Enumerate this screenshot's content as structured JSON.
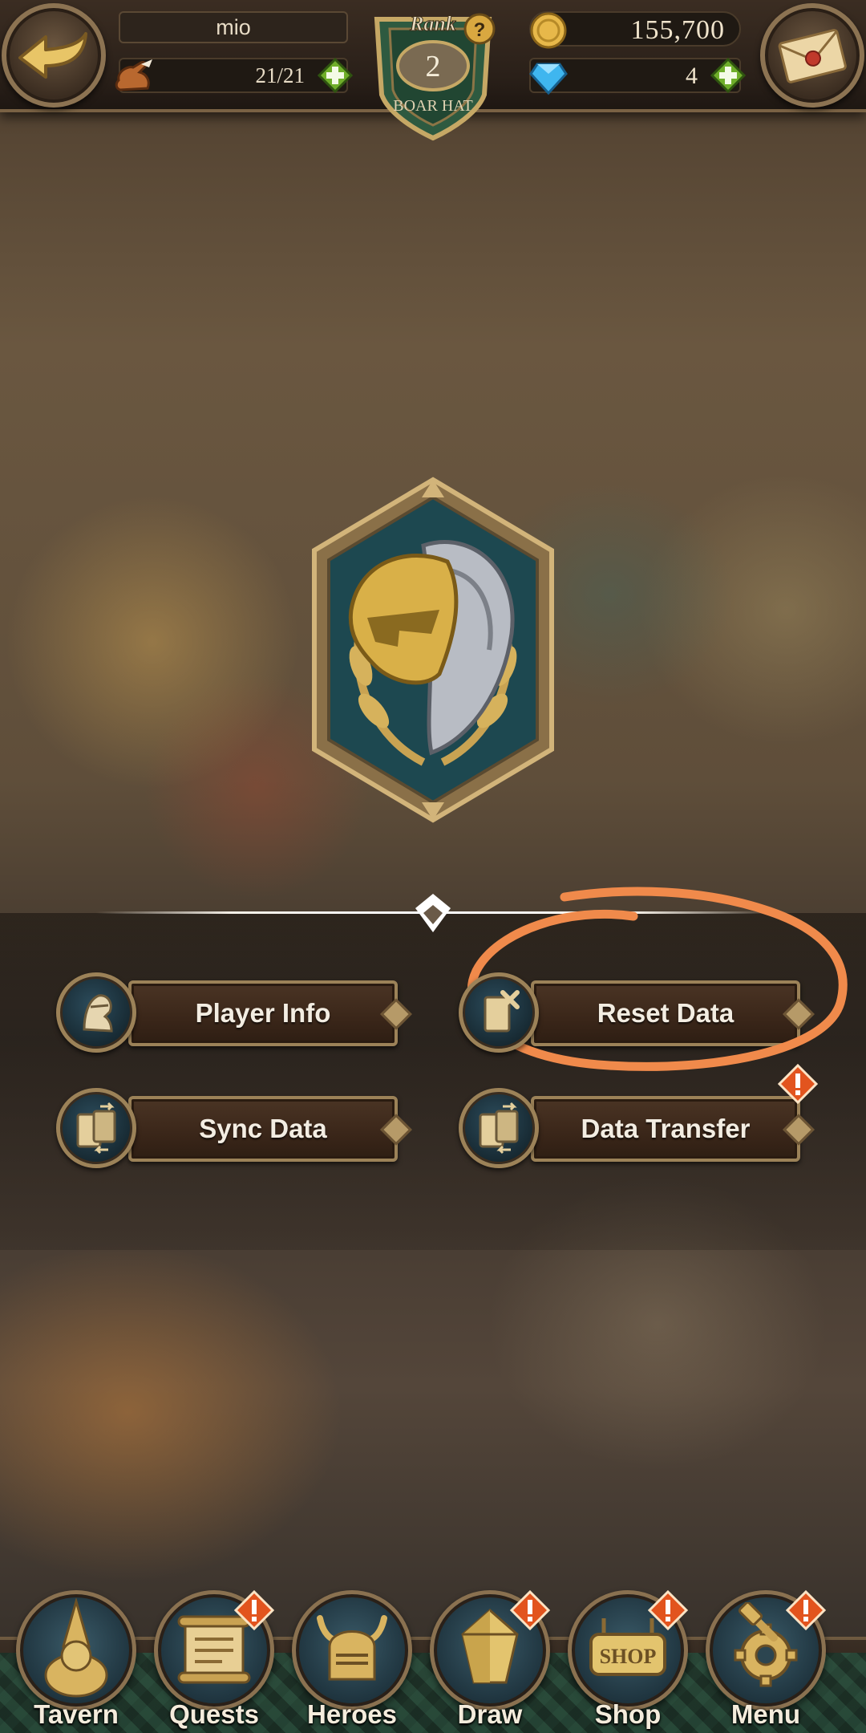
{
  "header": {
    "player_name": "mio",
    "stamina": "21/21",
    "rank_label": "Rank",
    "rank_value": "2",
    "rank_title": "BOAR HAT",
    "gold": "155,700",
    "gems": "4",
    "icons": {
      "back": "back-arrow-icon",
      "mail": "mail-envelope-icon",
      "stamina": "stamina-boot-icon",
      "gold": "gold-coin-icon",
      "gem": "blue-gem-icon",
      "help": "question-icon"
    }
  },
  "emblem": {
    "icon": "knight-helmet-emblem"
  },
  "options": [
    {
      "label": "Player Info",
      "icon": "knight-bust-icon",
      "alert": false
    },
    {
      "label": "Reset Data",
      "icon": "reset-card-icon",
      "alert": false
    },
    {
      "label": "Sync Data",
      "icon": "sync-card-icon",
      "alert": false
    },
    {
      "label": "Data Transfer",
      "icon": "transfer-card-icon",
      "alert": true
    }
  ],
  "annotation": {
    "color": "#f08a4b",
    "target": "Reset Data"
  },
  "bottom_nav": [
    {
      "label": "Tavern",
      "icon": "tavern-icon",
      "alert": false
    },
    {
      "label": "Quests",
      "icon": "quest-scroll-icon",
      "alert": true
    },
    {
      "label": "Heroes",
      "icon": "hero-helmet-icon",
      "alert": false
    },
    {
      "label": "Draw",
      "icon": "draw-crystal-icon",
      "alert": true
    },
    {
      "label": "Shop",
      "icon": "shop-sign-icon",
      "alert": true
    },
    {
      "label": "Menu",
      "icon": "menu-gear-icon",
      "alert": true
    }
  ],
  "colors": {
    "accent_gold": "#c9a75a",
    "alert_orange": "#e2541e",
    "plus_green": "#6fae2a"
  }
}
